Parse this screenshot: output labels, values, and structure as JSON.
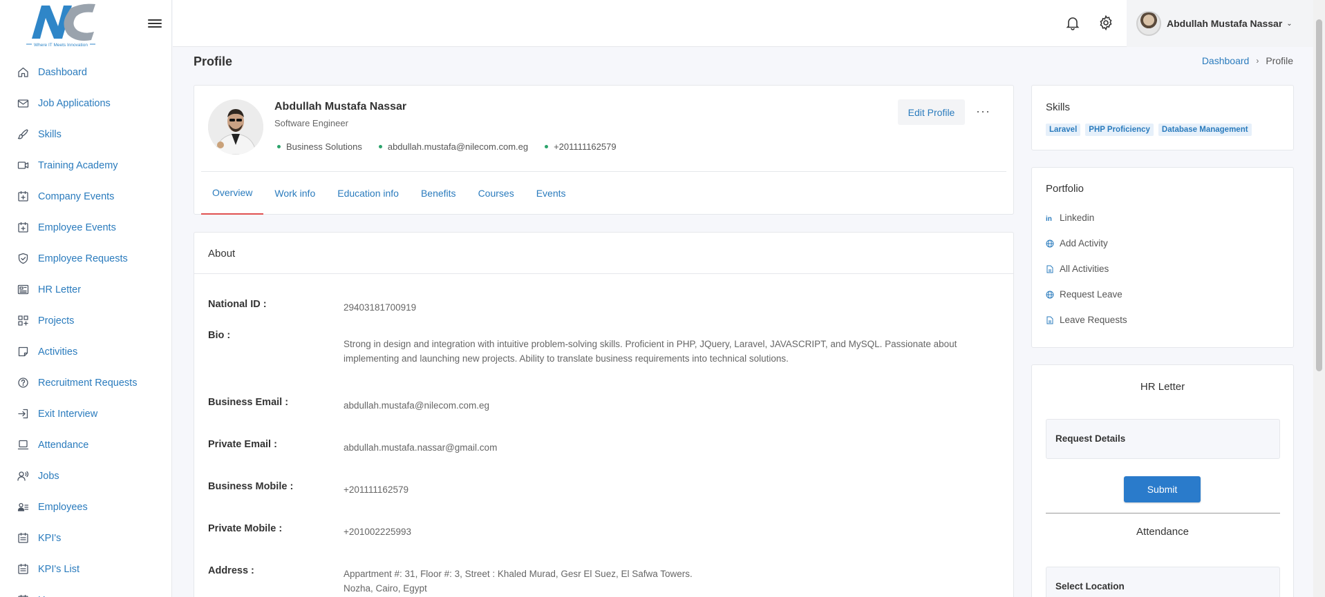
{
  "brand": {
    "logo_text": "NC",
    "tagline": "Where IT Meets Innovation",
    "colors": {
      "primary": "#2a7bbd",
      "accent_green": "#2ba36b",
      "tab_active": "#e05050"
    }
  },
  "sidebar": {
    "items": [
      {
        "label": "Dashboard",
        "icon": "home-icon"
      },
      {
        "label": "Job Applications",
        "icon": "mail-icon"
      },
      {
        "label": "Skills",
        "icon": "brush-icon"
      },
      {
        "label": "Training Academy",
        "icon": "video-icon"
      },
      {
        "label": "Company Events",
        "icon": "calendar-plus-icon"
      },
      {
        "label": "Employee Events",
        "icon": "calendar-plus-icon"
      },
      {
        "label": "Employee Requests",
        "icon": "shield-icon"
      },
      {
        "label": "HR Letter",
        "icon": "newspaper-icon"
      },
      {
        "label": "Projects",
        "icon": "grid-plus-icon"
      },
      {
        "label": "Activities",
        "icon": "note-icon"
      },
      {
        "label": "Recruitment Requests",
        "icon": "help-circle-icon"
      },
      {
        "label": "Exit Interview",
        "icon": "sign-in-icon"
      },
      {
        "label": "Attendance",
        "icon": "laptop-icon"
      },
      {
        "label": "Jobs",
        "icon": "users-sound-icon"
      },
      {
        "label": "Employees",
        "icon": "user-list-icon"
      },
      {
        "label": "KPI's",
        "icon": "calendar-list-icon"
      },
      {
        "label": "KPI's List",
        "icon": "calendar-list-icon"
      },
      {
        "label": "Users",
        "icon": "calendar-icon"
      }
    ]
  },
  "topbar": {
    "user_name": "Abdullah Mustafa Nassar"
  },
  "page": {
    "title": "Profile",
    "breadcrumb": {
      "home": "Dashboard",
      "current": "Profile"
    }
  },
  "profile": {
    "name": "Abdullah Mustafa Nassar",
    "job_title": "Software Engineer",
    "department": "Business Solutions",
    "email": "abdullah.mustafa@nilecom.com.eg",
    "phone": "+201111162579",
    "edit_label": "Edit Profile",
    "more_label": "···",
    "tabs": [
      "Overview",
      "Work info",
      "Education info",
      "Benefits",
      "Courses",
      "Events"
    ]
  },
  "about": {
    "title": "About",
    "fields": [
      {
        "label": "National ID :",
        "value": "29403181700919"
      },
      {
        "label": "Bio :",
        "value": "Strong in design and integration with intuitive problem-solving skills. Proficient in PHP, JQuery, Laravel, JAVASCRIPT, and MySQL. Passionate about implementing and launching new projects. Ability to translate business requirements into technical solutions."
      },
      {
        "label": "Business Email :",
        "value": "abdullah.mustafa@nilecom.com.eg"
      },
      {
        "label": "Private Email :",
        "value": "abdullah.mustafa.nassar@gmail.com"
      },
      {
        "label": "Business Mobile :",
        "value": "+201111162579"
      },
      {
        "label": "Private Mobile :",
        "value": "+201002225993"
      },
      {
        "label": "Address :",
        "value_line1": "Appartment #: 31, Floor #: 3, Street : Khaled Murad, Gesr El Suez, El Safwa Towers.",
        "value_line2": "Nozha, Cairo, Egypt"
      }
    ]
  },
  "skills": {
    "title": "Skills",
    "chips": [
      "Laravel",
      "PHP Proficiency",
      "Database Management"
    ]
  },
  "portfolio": {
    "title": "Portfolio",
    "items": [
      {
        "label": "Linkedin",
        "icon": "linkedin-icon"
      },
      {
        "label": "Add Activity",
        "icon": "globe-icon"
      },
      {
        "label": "All Activities",
        "icon": "file-icon"
      },
      {
        "label": "Request Leave",
        "icon": "globe-icon"
      },
      {
        "label": "Leave Requests",
        "icon": "file-icon"
      }
    ]
  },
  "hr_letter": {
    "title": "HR Letter",
    "field_label": "Request Details",
    "submit_label": "Submit",
    "attendance_title": "Attendance",
    "location_label": "Select Location"
  }
}
